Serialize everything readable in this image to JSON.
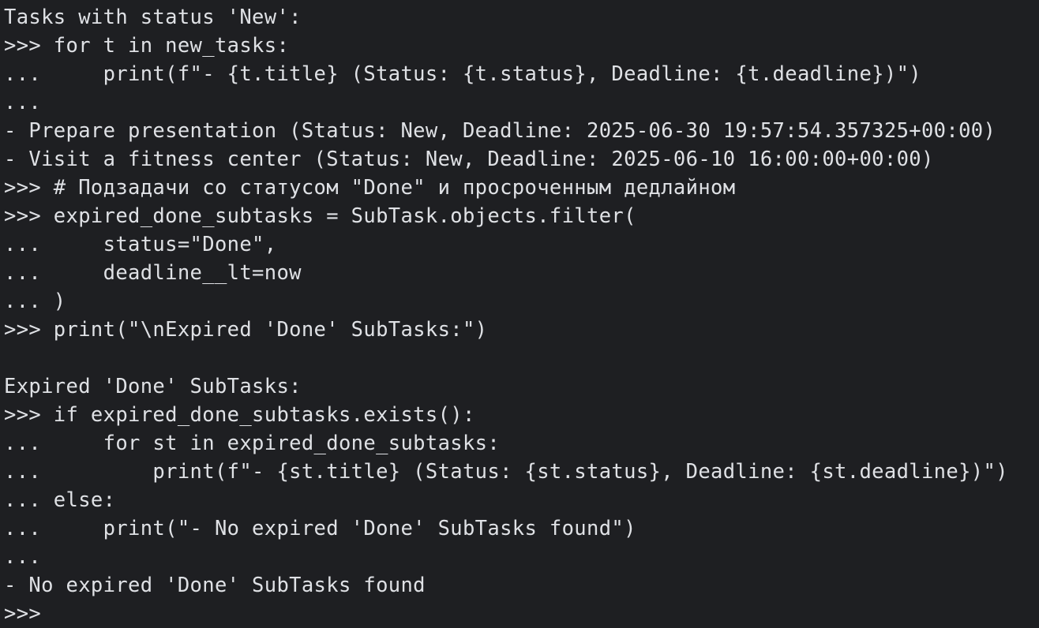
{
  "console": {
    "lines": [
      "Tasks with status 'New':",
      ">>> for t in new_tasks:",
      "...     print(f\"- {t.title} (Status: {t.status}, Deadline: {t.deadline})\")",
      "...",
      "- Prepare presentation (Status: New, Deadline: 2025-06-30 19:57:54.357325+00:00)",
      "- Visit a fitness center (Status: New, Deadline: 2025-06-10 16:00:00+00:00)",
      ">>> # Подзадачи со статусом \"Done\" и просроченным дедлайном",
      ">>> expired_done_subtasks = SubTask.objects.filter(",
      "...     status=\"Done\",",
      "...     deadline__lt=now",
      "... )",
      ">>> print(\"\\nExpired 'Done' SubTasks:\")",
      "",
      "Expired 'Done' SubTasks:",
      ">>> if expired_done_subtasks.exists():",
      "...     for st in expired_done_subtasks:",
      "...         print(f\"- {st.title} (Status: {st.status}, Deadline: {st.deadline})\")",
      "... else:",
      "...     print(\"- No expired 'Done' SubTasks found\")",
      "...",
      "- No expired 'Done' SubTasks found",
      ">>>"
    ]
  },
  "colors": {
    "background": "#1e1f22",
    "text": "#dfe1e5"
  }
}
